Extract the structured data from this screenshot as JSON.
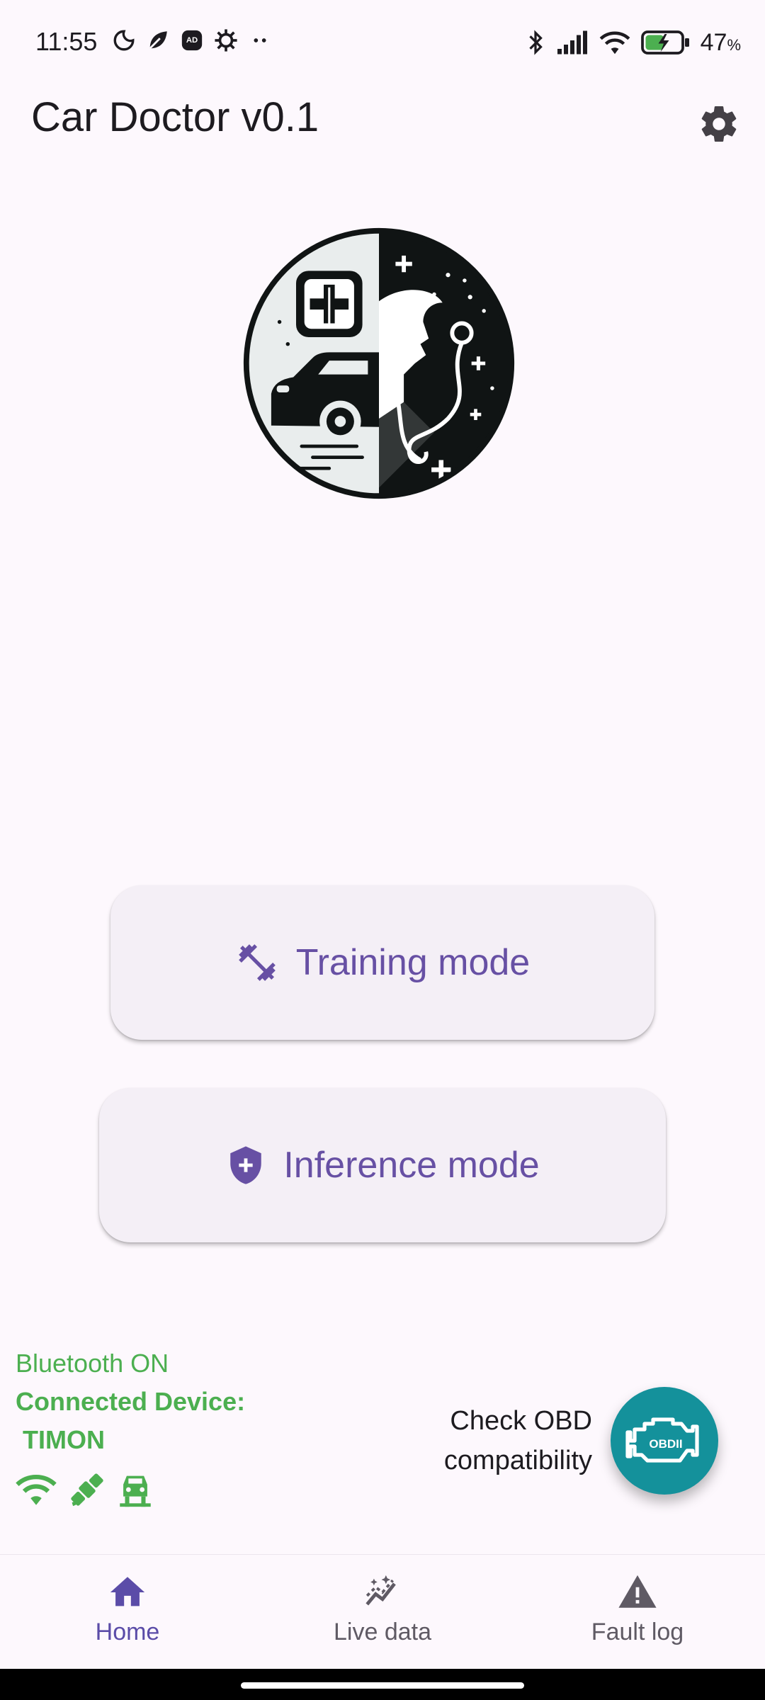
{
  "status_bar": {
    "time": "11:55",
    "battery_percent": "47",
    "battery_unit": "%",
    "left_icons": [
      "moon-icon",
      "leaf-icon",
      "adblocker-icon",
      "gear-small-icon",
      "more-dots-icon"
    ],
    "right_icons": [
      "bluetooth-icon",
      "signal-icon",
      "wifi-icon",
      "battery-charging-icon"
    ]
  },
  "app_bar": {
    "title": "Car Doctor v0.1",
    "settings_icon": "gear-icon"
  },
  "logo": {
    "icon": "car-doctor-logo"
  },
  "buttons": {
    "training": {
      "label": "Training mode",
      "icon": "dumbbell-icon"
    },
    "inference": {
      "label": "Inference mode",
      "icon": "shield-plus-icon"
    }
  },
  "bluetooth": {
    "status": "Bluetooth ON",
    "connected_label": "Connected Device:",
    "device_name": "TIMON",
    "indicator_icons": [
      "wifi-icon",
      "satellite-icon",
      "car-icon"
    ],
    "color": "#4caf50"
  },
  "obd": {
    "label_line1": "Check OBD",
    "label_line2": "compatibility",
    "fab_text": "OBDII",
    "color": "#14919b"
  },
  "bottom_nav": {
    "items": [
      {
        "label": "Home",
        "icon": "home-icon",
        "active": true
      },
      {
        "label": "Live data",
        "icon": "auto-graph-icon",
        "active": false
      },
      {
        "label": "Fault log",
        "icon": "warning-icon",
        "active": false
      }
    ]
  },
  "colors": {
    "accent": "#6750a4",
    "background": "#fdf8fd"
  }
}
